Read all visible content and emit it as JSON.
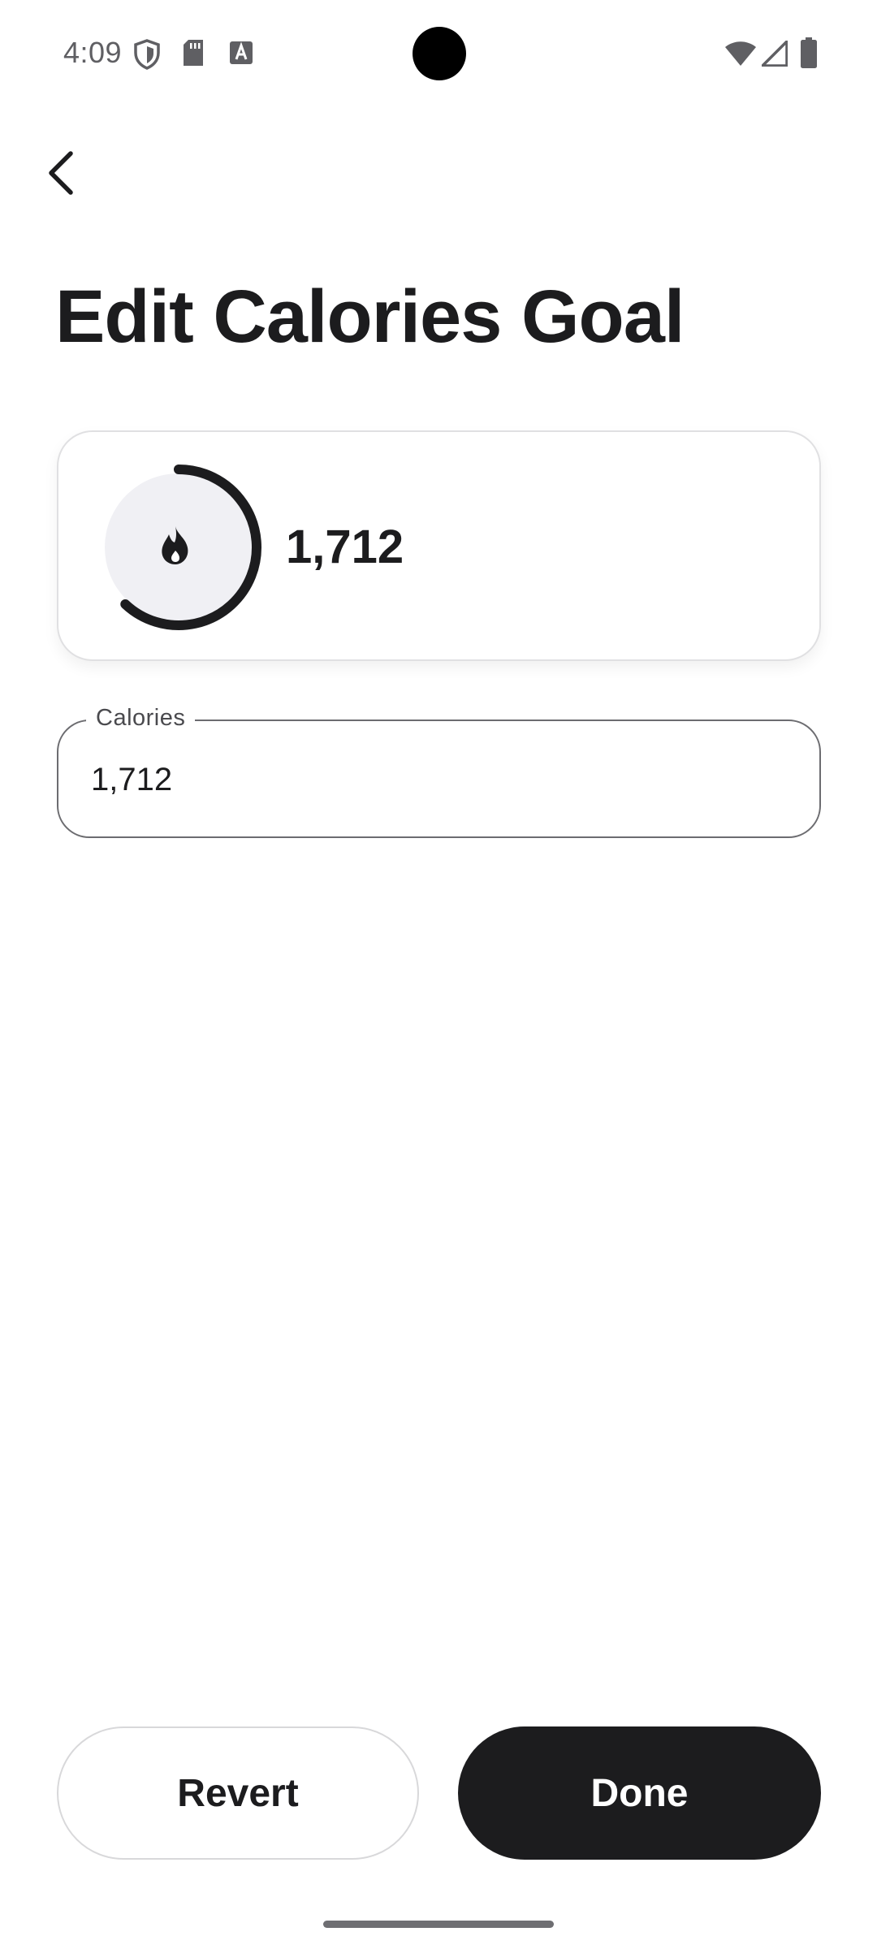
{
  "status_bar": {
    "time": "4:09",
    "icons": [
      "shield-icon",
      "sd-card-icon",
      "font-a-icon",
      "wifi-icon",
      "cellular-signal-icon",
      "battery-icon"
    ]
  },
  "navigation": {
    "back_icon": "chevron-left-icon"
  },
  "page": {
    "title": "Edit Calories Goal"
  },
  "summary_card": {
    "icon": "flame-icon",
    "value": "1,712",
    "ring_progress_fraction": 0.62,
    "ring_color": "#1c1c1e",
    "ring_track_color": "#f0f0f4"
  },
  "calories_field": {
    "label": "Calories",
    "value": "1,712"
  },
  "actions": {
    "revert_label": "Revert",
    "done_label": "Done"
  },
  "colors": {
    "primary": "#1c1c1e",
    "background": "#ffffff",
    "outline": "#6c6c70"
  }
}
